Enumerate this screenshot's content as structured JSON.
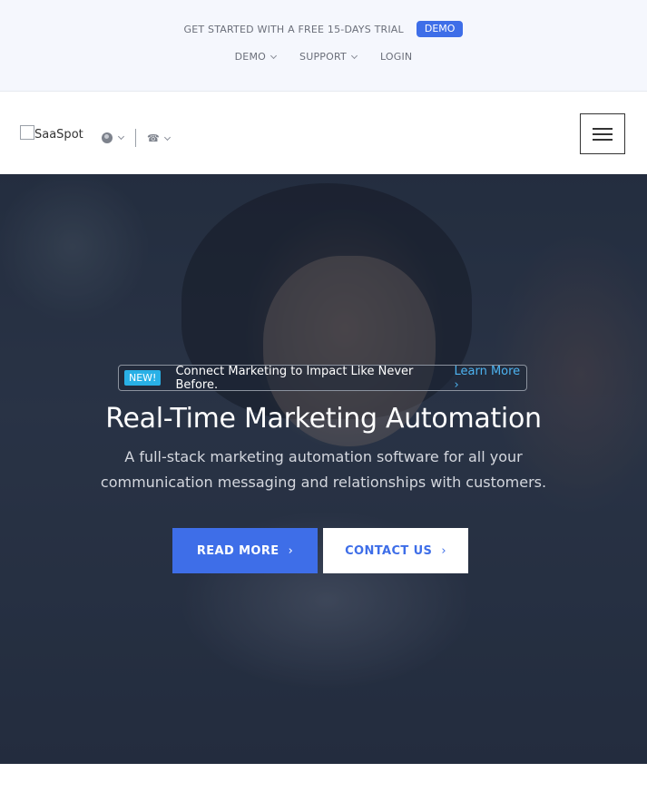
{
  "topbar": {
    "trial_text": "GET STARTED WITH A FREE 15-DAYS TRIAL",
    "demo_badge": "DEMO",
    "nav": [
      {
        "label": "DEMO",
        "has_dropdown": true
      },
      {
        "label": "SUPPORT",
        "has_dropdown": true
      },
      {
        "label": "LOGIN",
        "has_dropdown": false
      }
    ]
  },
  "header": {
    "logo_text": "SaaSpot",
    "language_icon": "globe-icon",
    "contact_icon": "phone-icon",
    "menu_icon": "hamburger-icon"
  },
  "hero": {
    "badge": "NEW!",
    "announcement": "Connect Marketing to Impact Like Never Before.",
    "announcement_link": "Learn More",
    "title": "Real-Time Marketing Automation",
    "subtitle": "A full-stack marketing automation software for all your communication messaging and relationships with customers.",
    "primary_button": "READ MORE",
    "secondary_button": "CONTACT US"
  },
  "colors": {
    "accent": "#3e6ee8",
    "badge": "#29b0e6",
    "topbar_bg": "#f5f7fd"
  }
}
